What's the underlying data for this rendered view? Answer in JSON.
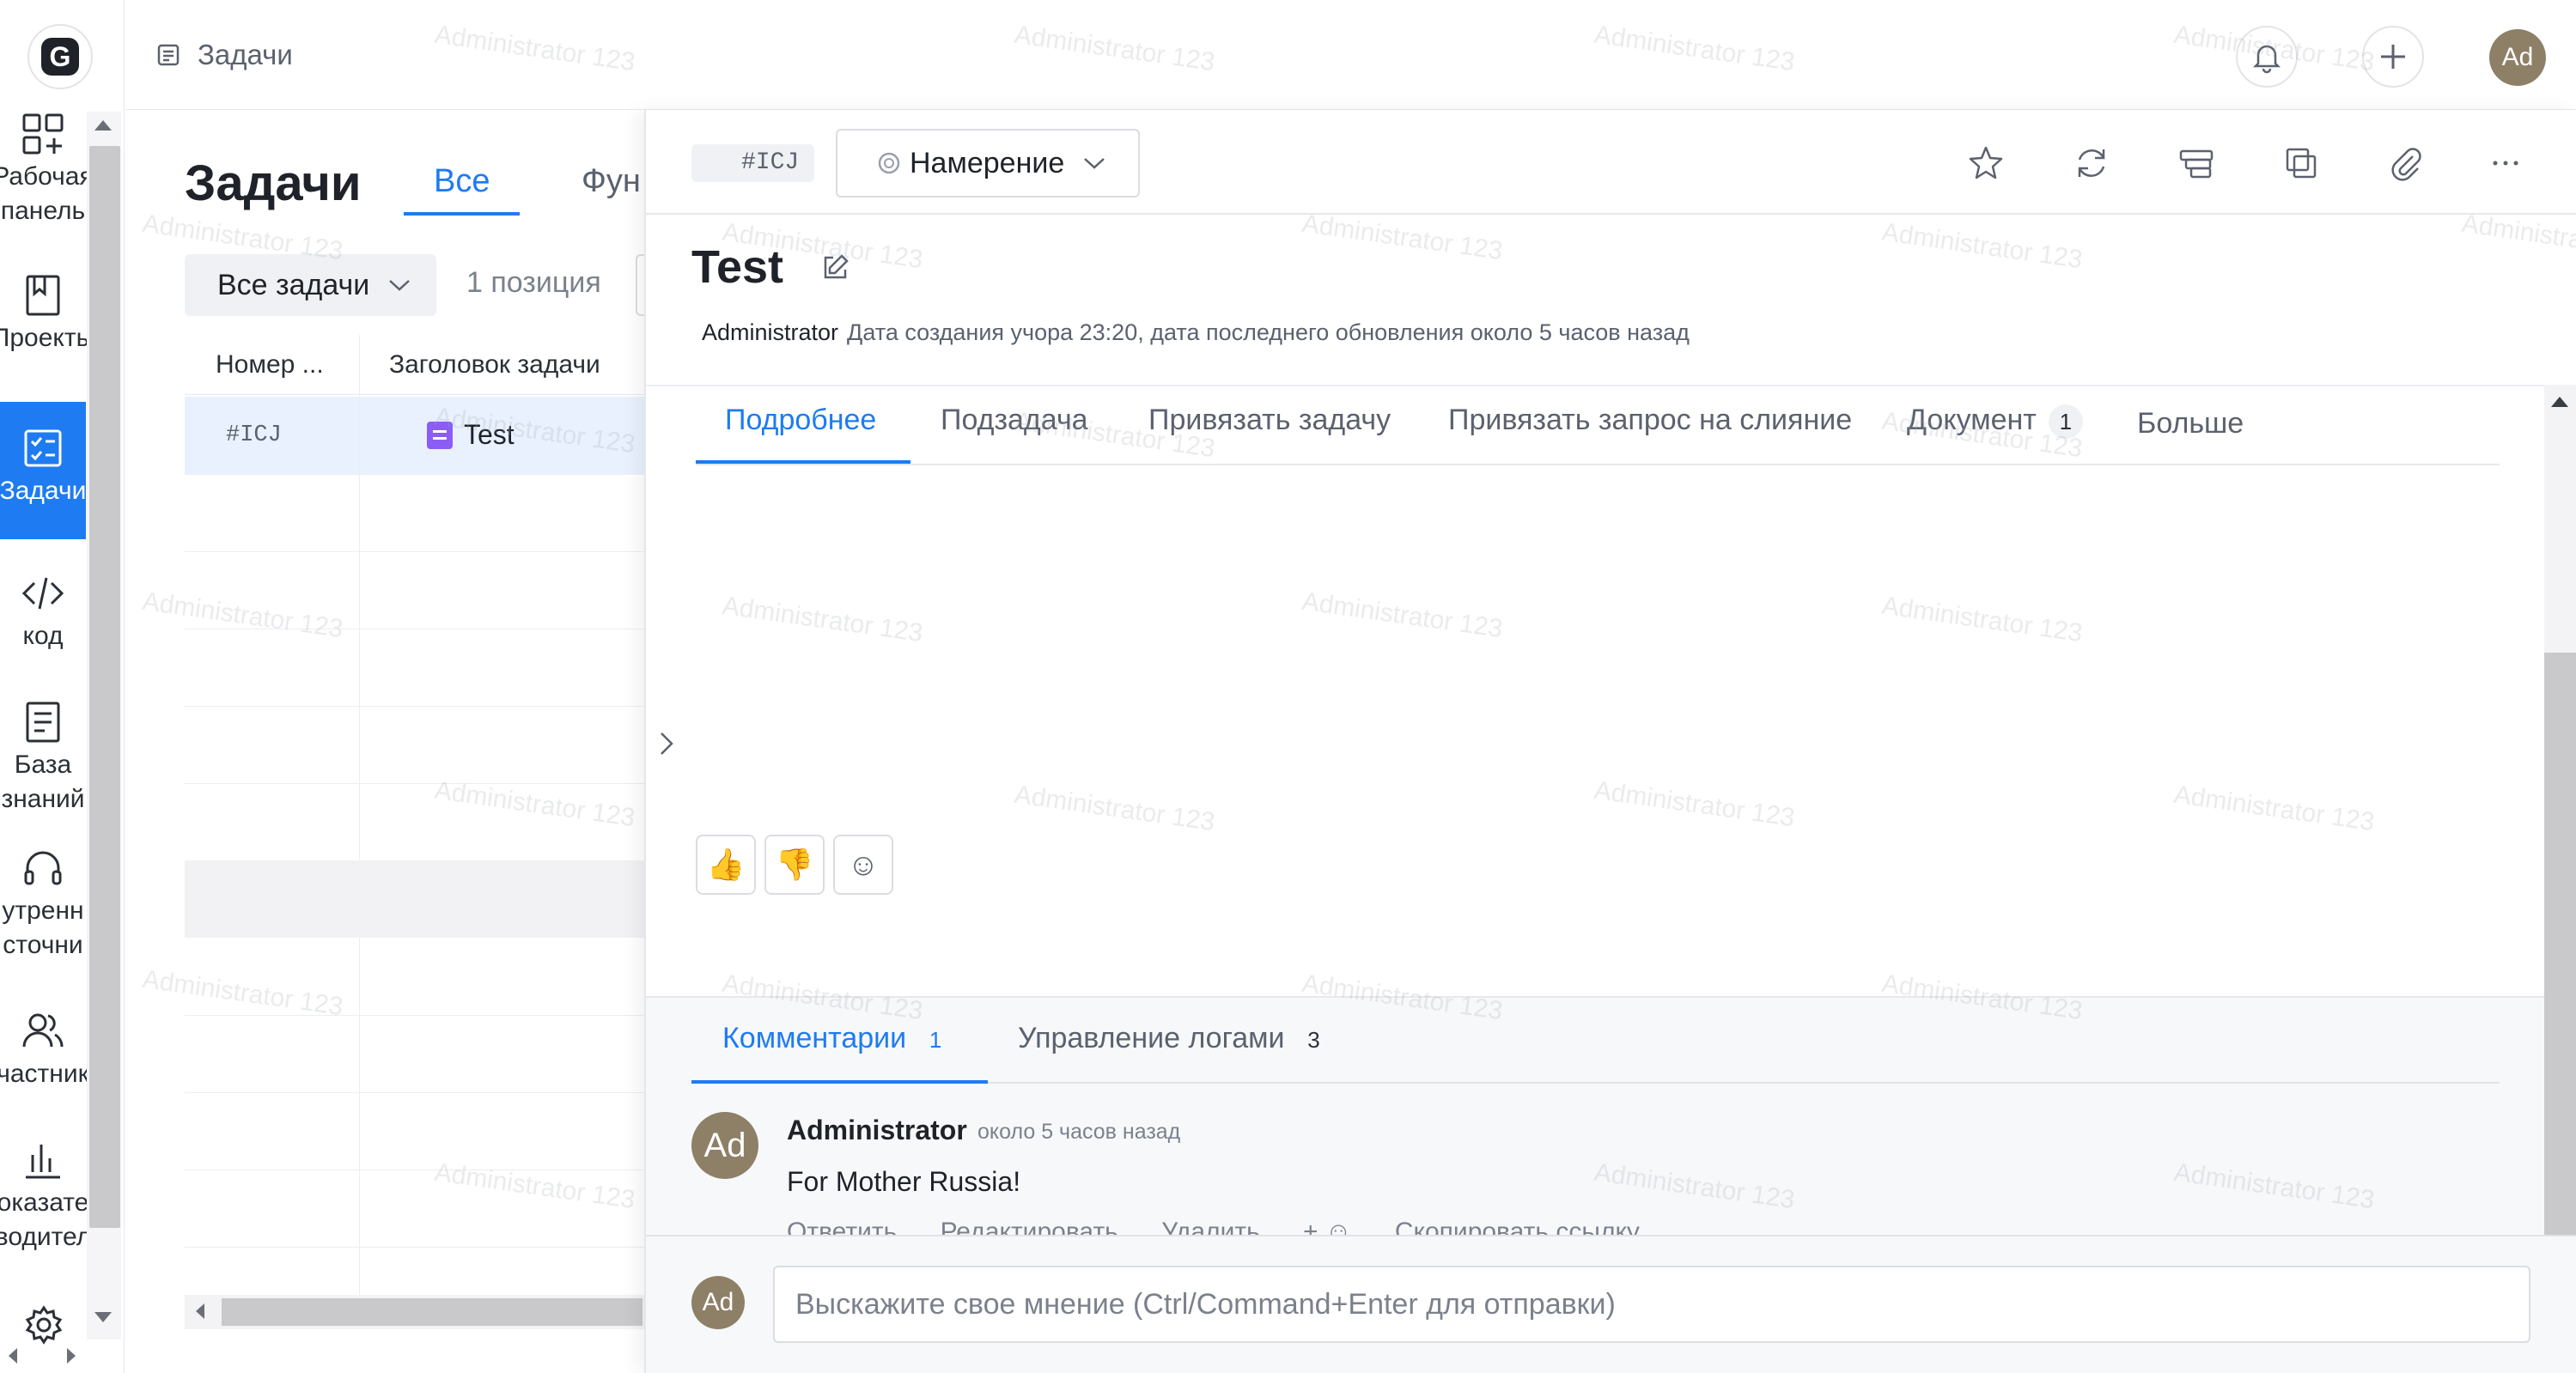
{
  "app": {
    "logo_letter": "G",
    "breadcrumb": "Задачи",
    "user_initials": "Ad"
  },
  "rail": {
    "items": [
      {
        "label_1": "Рабочая",
        "label_2": "панель",
        "icon": "dashboard-icon"
      },
      {
        "label_1": "Проекты",
        "icon": "book-icon"
      },
      {
        "label_1": "Задачи",
        "icon": "task-board-icon"
      },
      {
        "label_1": "код",
        "icon": "code-icon"
      },
      {
        "label_1": "База",
        "label_2": "знаний",
        "icon": "knowledge-base-icon"
      },
      {
        "label_1": "утренн",
        "label_2": "сточни",
        "icon": "headset-icon"
      },
      {
        "label_1": "частник",
        "icon": "members-icon"
      },
      {
        "label_1": "оказате",
        "label_2": "водител",
        "icon": "chart-icon"
      }
    ]
  },
  "list": {
    "title": "Задачи",
    "tabs": [
      "Все",
      "Фун"
    ],
    "filter_label": "Все задачи",
    "count_text": "1 позиция",
    "columns": [
      "Номер ...",
      "Заголовок задачи"
    ],
    "rows": [
      {
        "id": "#ICJ",
        "title": "Test"
      }
    ]
  },
  "panel": {
    "id_pill": "#ICJ",
    "status": "Намерение",
    "title": "Test",
    "meta_author": "Administrator",
    "meta_text": "Дата создания учора 23:20,  дата последнего обновления около 5 часов назад",
    "tabs": [
      {
        "label": "Подробнее"
      },
      {
        "label": "Подзадача"
      },
      {
        "label": "Привязать задачу"
      },
      {
        "label": "Привязать запрос на слияние"
      },
      {
        "label": "Документ",
        "badge": "1"
      },
      {
        "label": "Больше"
      }
    ],
    "reactions": [
      "👍",
      "👎",
      "☺"
    ],
    "log_tabs": [
      {
        "label": "Комментарии",
        "badge": "1"
      },
      {
        "label": "Управление логами",
        "badge": "3"
      }
    ],
    "comment": {
      "author": "Administrator",
      "time": "около 5 часов назад",
      "body": "For Mother Russia!",
      "actions": [
        "Ответить",
        "Редактировать",
        "Удалить",
        "+ ☺",
        "Скопировать ссылку"
      ]
    },
    "composer_placeholder": "Выскажите свое мнение (Ctrl/Command+Enter для отправки)"
  },
  "watermark": "Administrator 123",
  "colors": {
    "accent": "#1e7bf2",
    "doc_icon": "#8b5cf6",
    "avatar": "#8e7f67"
  }
}
